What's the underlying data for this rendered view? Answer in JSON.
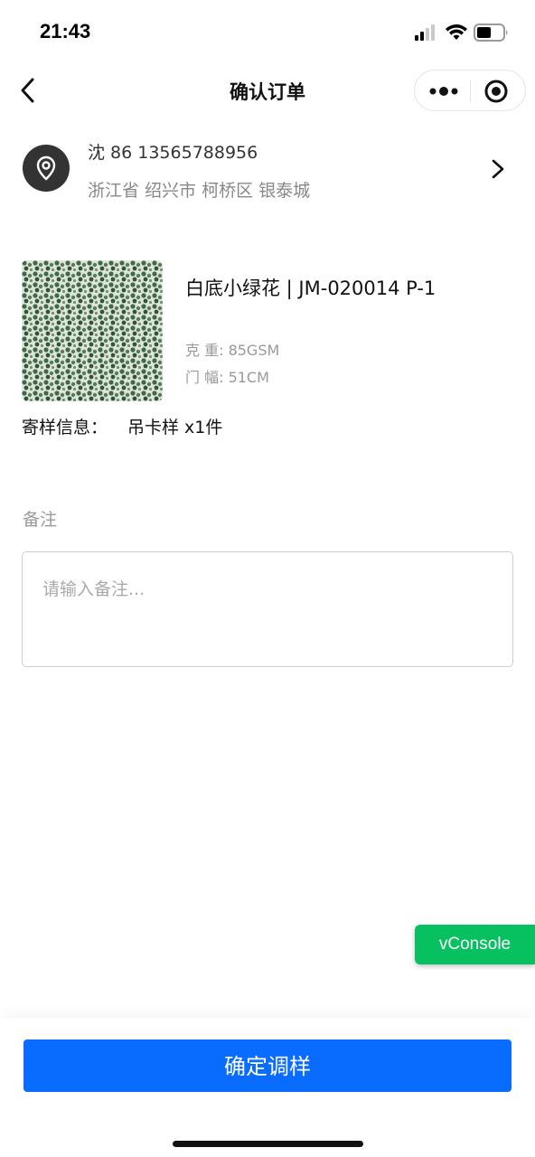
{
  "status_bar": {
    "time": "21:43",
    "icons": [
      "signal-icon",
      "wifi-icon",
      "battery-icon"
    ]
  },
  "nav": {
    "title": "确认订单",
    "icons": [
      "back-icon",
      "more-icon",
      "mini-program-close-icon"
    ]
  },
  "address": {
    "name_phone": "沈 86 13565788956",
    "detail": "浙江省 绍兴市 柯桥区 银泰城",
    "icon": "location-pin-icon"
  },
  "product": {
    "name": "白底小绿花 | JM-020014 P-1",
    "weight": "克 重: 85GSM",
    "width": "门 幅: 51CM",
    "sample_label": "寄样信息：",
    "sample_value": "吊卡样 x1件"
  },
  "remark": {
    "label": "备注",
    "placeholder": "请输入备注...",
    "value": ""
  },
  "vconsole": {
    "label": "vConsole"
  },
  "footer": {
    "confirm_label": "确定调样"
  },
  "colors": {
    "primary": "#0a6cff",
    "vconsole": "#07c160",
    "muted": "#999999"
  }
}
